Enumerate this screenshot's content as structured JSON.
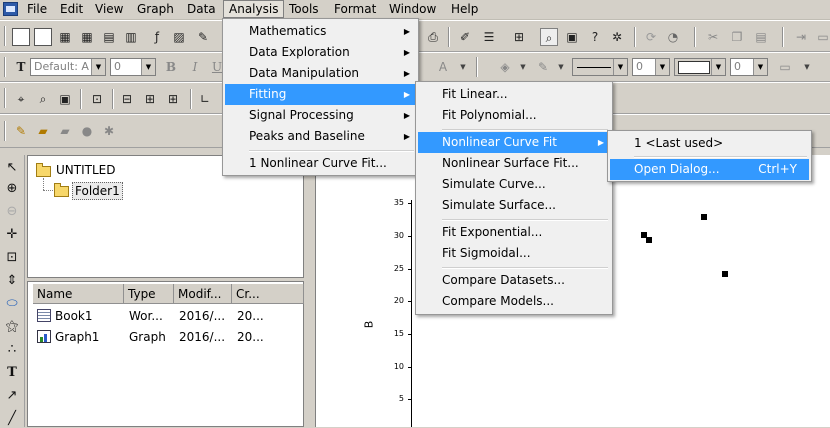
{
  "menubar": {
    "items": [
      "File",
      "Edit",
      "View",
      "Graph",
      "Data",
      "Analysis",
      "Tools",
      "Format",
      "Window",
      "Help"
    ]
  },
  "format_toolbar": {
    "font_name": "Default: A",
    "font_size": "0",
    "bold": "B",
    "italic": "I",
    "underline": "U",
    "line_width": "0",
    "border_width": "0"
  },
  "analysis_menu": {
    "items": [
      "Mathematics",
      "Data Exploration",
      "Data Manipulation",
      "Fitting",
      "Signal Processing",
      "Peaks and Baseline"
    ],
    "recent": "1 Nonlinear Curve Fit..."
  },
  "fitting_menu": {
    "fit_linear": "Fit Linear...",
    "fit_polynomial": "Fit Polynomial...",
    "nonlinear_curve_fit": "Nonlinear Curve Fit",
    "nonlinear_surface_fit": "Nonlinear Surface Fit...",
    "simulate_curve": "Simulate Curve...",
    "simulate_surface": "Simulate Surface...",
    "fit_exponential": "Fit Exponential...",
    "fit_sigmoidal": "Fit Sigmoidal...",
    "compare_datasets": "Compare Datasets...",
    "compare_models": "Compare Models..."
  },
  "nlfit_menu": {
    "last_used": "1 <Last used>",
    "open_dialog": "Open Dialog...",
    "open_dialog_shortcut": "Ctrl+Y"
  },
  "project_explorer": {
    "root": "UNTITLED",
    "folder": "Folder1",
    "columns": [
      "Name",
      "Type",
      "Modif...",
      "Cr..."
    ],
    "rows": [
      {
        "name": "Book1",
        "type": "Wor...",
        "modified": "2016/...",
        "created": "20..."
      },
      {
        "name": "Graph1",
        "type": "Graph",
        "modified": "2016/...",
        "created": "20..."
      }
    ]
  },
  "graph": {
    "y_axis_label": "B",
    "y_ticks": [
      "35",
      "30",
      "25",
      "20",
      "15",
      "10",
      "5"
    ]
  }
}
